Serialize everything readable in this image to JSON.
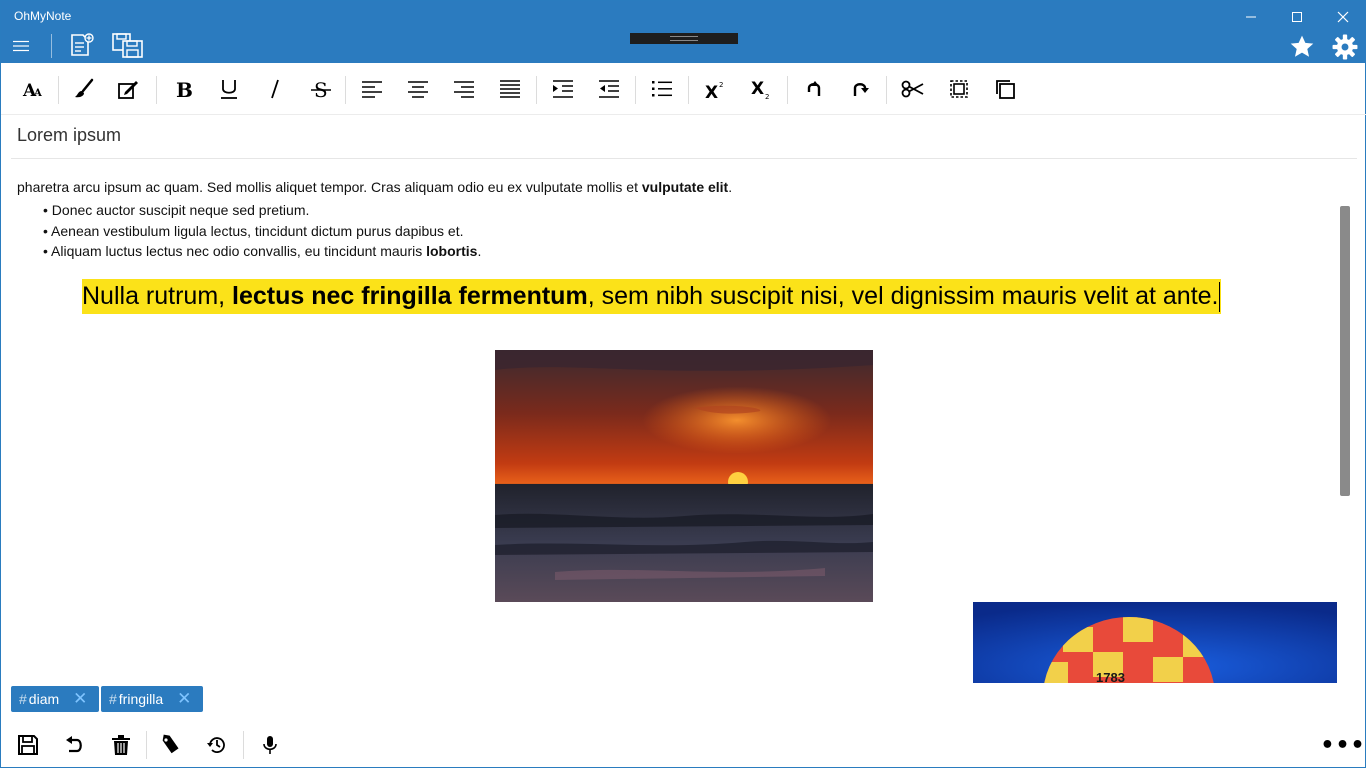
{
  "app": {
    "title": "OhMyNote"
  },
  "window_controls": {
    "minimize": "—",
    "maximize": "☐",
    "close": "✕"
  },
  "colors": {
    "accent": "#2b7bbf",
    "highlight": "#fbe219",
    "tag_close": "#7fc4ff"
  },
  "titlebar_icons": [
    "menu-icon",
    "new-note-icon",
    "save-all-icon",
    "star-icon",
    "settings-icon"
  ],
  "toolbar": {
    "icons": [
      "font-size-icon",
      "brush-icon",
      "edit-box-icon",
      "bold-icon",
      "underline-icon",
      "italic-icon",
      "strikethrough-icon",
      "align-left-icon",
      "align-center-icon",
      "align-right-icon",
      "justify-icon",
      "indent-increase-icon",
      "indent-decrease-icon",
      "bullet-list-icon",
      "superscript-icon",
      "subscript-icon",
      "undo-icon",
      "redo-icon",
      "cut-icon",
      "select-all-icon",
      "copy-icon"
    ]
  },
  "note": {
    "title": "Lorem ipsum",
    "paragraph": {
      "text": "pharetra arcu ipsum ac quam. Sed mollis aliquet tempor. Cras aliquam odio eu ex vulputate mollis et ",
      "bold": "vulputate elit",
      "tail": "."
    },
    "bullets": [
      {
        "text": "Donec auctor suscipit neque sed pretium.",
        "bold": "",
        "tail": ""
      },
      {
        "text": "Aenean vestibulum ligula lectus, tincidunt dictum purus dapibus et.",
        "bold": "",
        "tail": ""
      },
      {
        "text": "Aliquam luctus lectus nec odio convallis, eu tincidunt mauris ",
        "bold": "lobortis",
        "tail": "."
      }
    ],
    "highlight": {
      "before": "Nulla rutrum, ",
      "bold": "lectus nec fringilla fermentum",
      "after": ", sem nibh suscipit nisi, vel dignissim mauris velit at ante."
    },
    "balloon_number": "1783"
  },
  "tags": [
    {
      "hash": "#",
      "label": "diam",
      "close": "✕"
    },
    {
      "hash": "#",
      "label": "fringilla",
      "close": "✕"
    }
  ],
  "bottombar": {
    "icons": [
      "save-icon",
      "undo-icon",
      "delete-icon",
      "tag-icon",
      "history-icon",
      "microphone-icon"
    ],
    "more": "•••"
  }
}
